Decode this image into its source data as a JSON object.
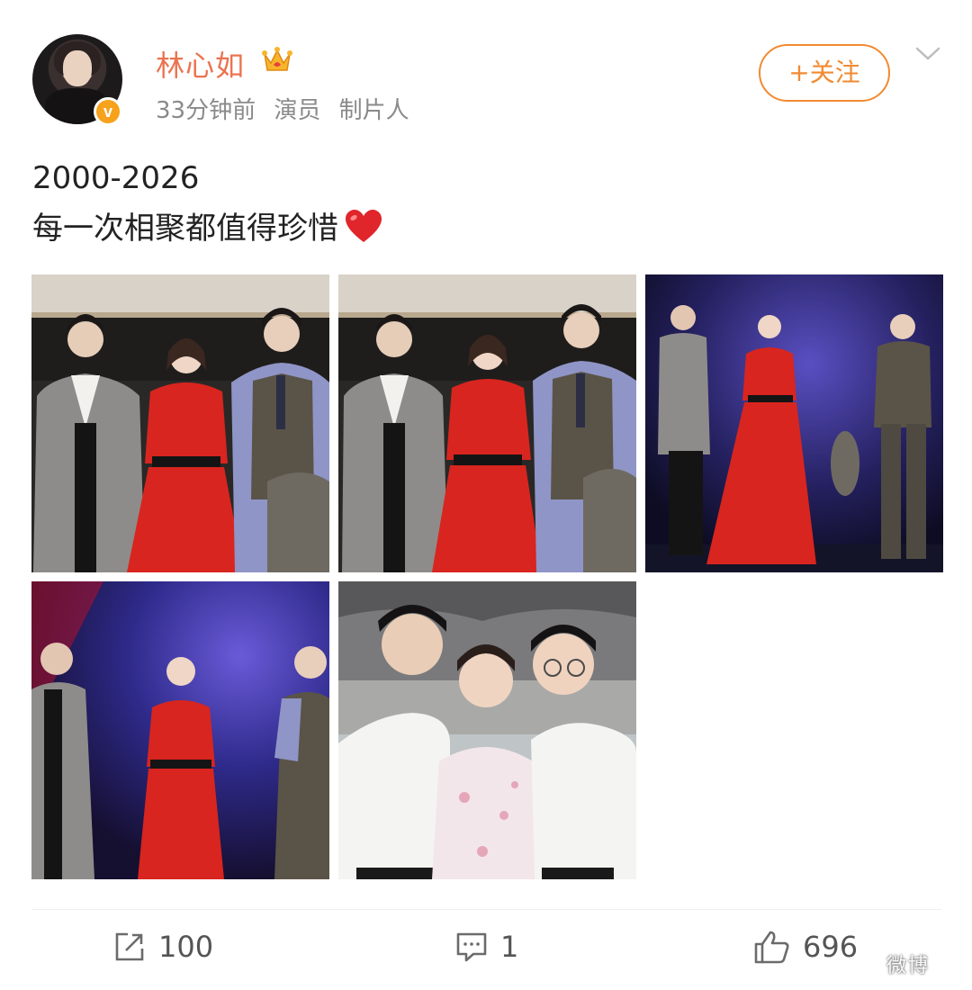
{
  "post": {
    "author": {
      "name": "林心如",
      "verified_mark": "v",
      "badge_icon": "crown-icon"
    },
    "meta": {
      "time": "33分钟前",
      "tags": [
        "演员",
        "制片人"
      ]
    },
    "follow_button": "+关注",
    "text_lines": [
      "2000-2026",
      "每一次相聚都值得珍惜"
    ],
    "emoji": "heart-icon",
    "images": [
      "photo-1",
      "photo-2",
      "photo-3",
      "photo-4",
      "photo-5"
    ]
  },
  "actions": {
    "repost_count": "100",
    "comment_count": "1",
    "like_count": "696"
  },
  "watermark": "微博",
  "colors": {
    "name": "#eb7350",
    "follow": "#f28a32",
    "verified": "#f7a21c",
    "red_dress": "#d8251f"
  }
}
